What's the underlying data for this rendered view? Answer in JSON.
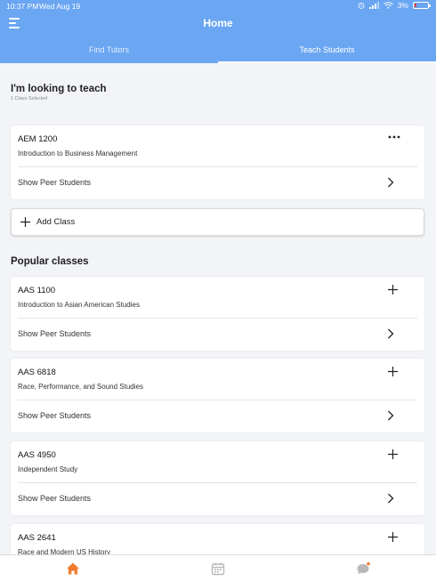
{
  "status": {
    "time": "10:37 PM",
    "date": "Wed Aug 19",
    "battery": "3%"
  },
  "header": {
    "title": "Home"
  },
  "tabs": [
    {
      "label": "Find Tutors"
    },
    {
      "label": "Teach Students"
    }
  ],
  "teach": {
    "title": "I'm looking to teach",
    "subtitle": "1 Class Selected",
    "classes": [
      {
        "code": "AEM 1200",
        "name": "Introduction to Business Management",
        "action": "Show Peer Students"
      }
    ],
    "add_class": "Add Class"
  },
  "popular": {
    "title": "Popular classes",
    "classes": [
      {
        "code": "AAS 1100",
        "name": "Introduction to Asian American Studies",
        "action": "Show Peer Students"
      },
      {
        "code": "AAS 6818",
        "name": "Race, Performance, and Sound Studies",
        "action": "Show Peer Students"
      },
      {
        "code": "AAS 4950",
        "name": "Independent Study",
        "action": "Show Peer Students"
      },
      {
        "code": "AAS 2641",
        "name": "Race and Modern US History",
        "action": ""
      }
    ]
  },
  "bottom_nav": [
    {
      "icon": "home-icon"
    },
    {
      "icon": "calendar-icon"
    },
    {
      "icon": "chat-icon"
    }
  ],
  "colors": {
    "header": "#6aa6f2",
    "active_nav": "#f07d2d",
    "notification_dot": "#f07d2d",
    "inactive_nav": "#b9b9b9"
  }
}
